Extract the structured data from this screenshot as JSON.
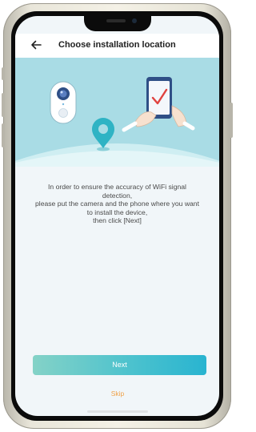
{
  "header": {
    "back_icon": "arrow-left-icon",
    "title": "Choose installation location"
  },
  "hero": {
    "icons": [
      "camera-device-icon",
      "location-pin-icon",
      "phone-checkmark-icon"
    ]
  },
  "instructions": {
    "line1": "In order to ensure the accuracy of WiFi signal",
    "line2": "detection,",
    "line3": "please put the camera and the phone where you want",
    "line4": "to install the device,",
    "line5": "then click [Next]"
  },
  "actions": {
    "next_label": "Next",
    "skip_label": "Skip"
  },
  "colors": {
    "hero_background": "#a9dce5",
    "next_button_start": "#84d2c7",
    "next_button_end": "#29b4d0",
    "skip_text": "#f0a24a",
    "screen_background": "#f1f6f9"
  }
}
